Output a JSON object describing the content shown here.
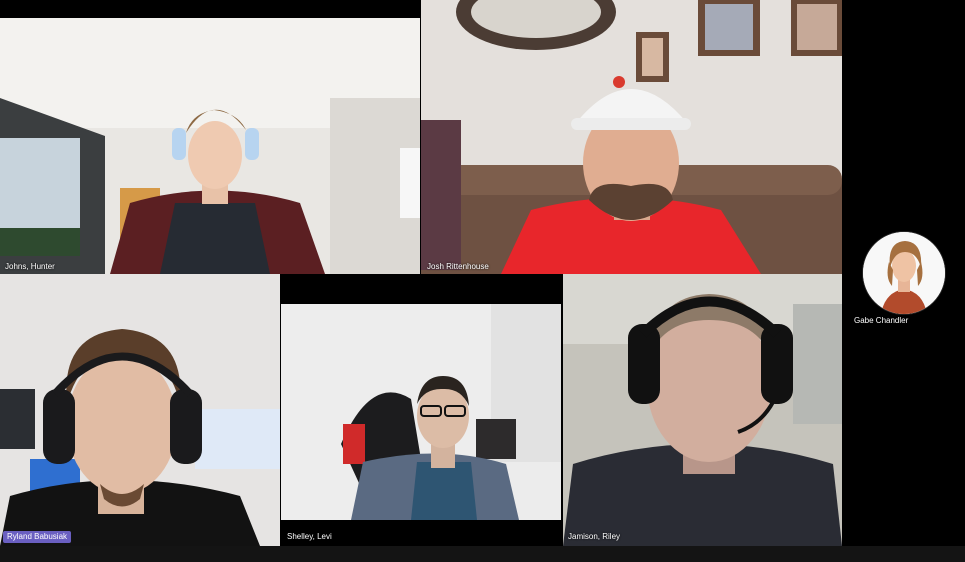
{
  "participants": [
    {
      "name": "Johns, Hunter"
    },
    {
      "name": "Josh Rittenhouse"
    },
    {
      "name": "Ryland Babusiak"
    },
    {
      "name": "Shelley, Levi"
    },
    {
      "name": "Jamison, Riley"
    },
    {
      "name": "Gabe Chandler"
    }
  ],
  "active_speaker_color": "#6a5fc1"
}
